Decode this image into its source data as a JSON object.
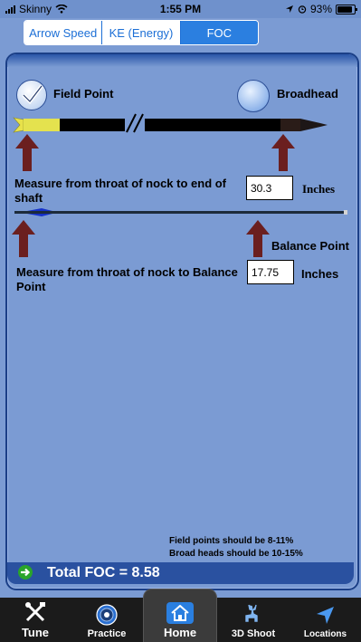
{
  "status": {
    "carrier": "Skinny",
    "time": "1:55 PM",
    "battery": "93%"
  },
  "tabs_top": [
    {
      "label": "Arrow Speed"
    },
    {
      "label": "KE (Energy)"
    },
    {
      "label": "FOC",
      "active": true
    }
  ],
  "point_options": {
    "field_point": "Field Point",
    "broadhead": "Broadhead",
    "selected": "field_point"
  },
  "shaft": {
    "measure_label": "Measure from throat of nock to end of shaft",
    "value": "30.3",
    "units": "Inches"
  },
  "balance": {
    "label": "Balance Point",
    "measure_label": "Measure from throat of nock to Balance Point",
    "value": "17.75",
    "units": "Inches"
  },
  "notes": [
    "Field points should be 8-11%",
    "Broad heads should be 10-15%"
  ],
  "total": {
    "text": "Total FOC = 8.58"
  },
  "bottom_tabs": [
    {
      "label": "Tune",
      "icon": "tools-icon"
    },
    {
      "label": "Practice",
      "icon": "target-icon"
    },
    {
      "label": "Home",
      "icon": "home-icon",
      "active": true
    },
    {
      "label": "3D Shoot",
      "icon": "deer-icon"
    },
    {
      "label": "Locations",
      "icon": "location-arrow-icon"
    }
  ],
  "colors": {
    "background": "#7b9bd3",
    "arrow_marker": "#6b1f1f",
    "accent": "#2b7fe0"
  }
}
